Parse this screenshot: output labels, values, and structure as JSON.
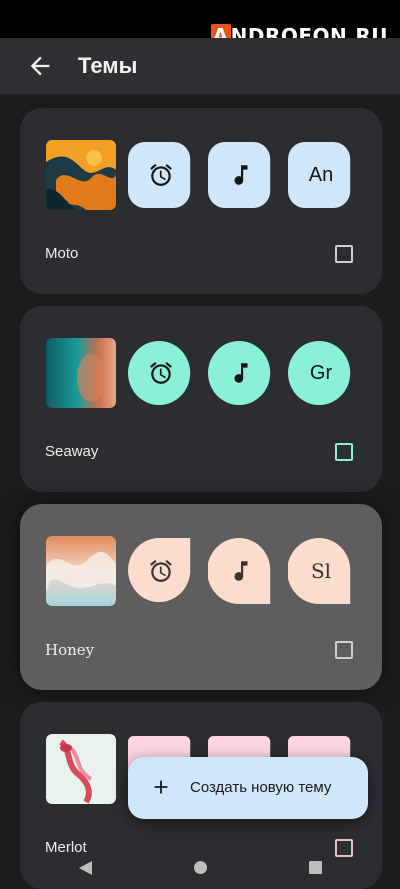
{
  "watermark": {
    "first": "A",
    "rest": "NDROFON.RU"
  },
  "appbar": {
    "title": "Темы"
  },
  "themes": [
    {
      "name": "Moto",
      "chip_color": "#cfe6fb",
      "chip_text": "An",
      "shape": "squircle",
      "label_font": "sans"
    },
    {
      "name": "Seaway",
      "chip_color": "#8af0d8",
      "chip_text": "Gr",
      "shape": "circle",
      "label_font": "sans"
    },
    {
      "name": "Honey",
      "chip_color": "#fbdccd",
      "chip_text": "Sl",
      "shape": "leaf",
      "label_font": "serif"
    },
    {
      "name": "Merlot",
      "chip_color": "#fcd3e0",
      "chip_text": "",
      "shape": "rounded",
      "label_font": "sans"
    }
  ],
  "fab": {
    "label": "Создать новую тему"
  }
}
